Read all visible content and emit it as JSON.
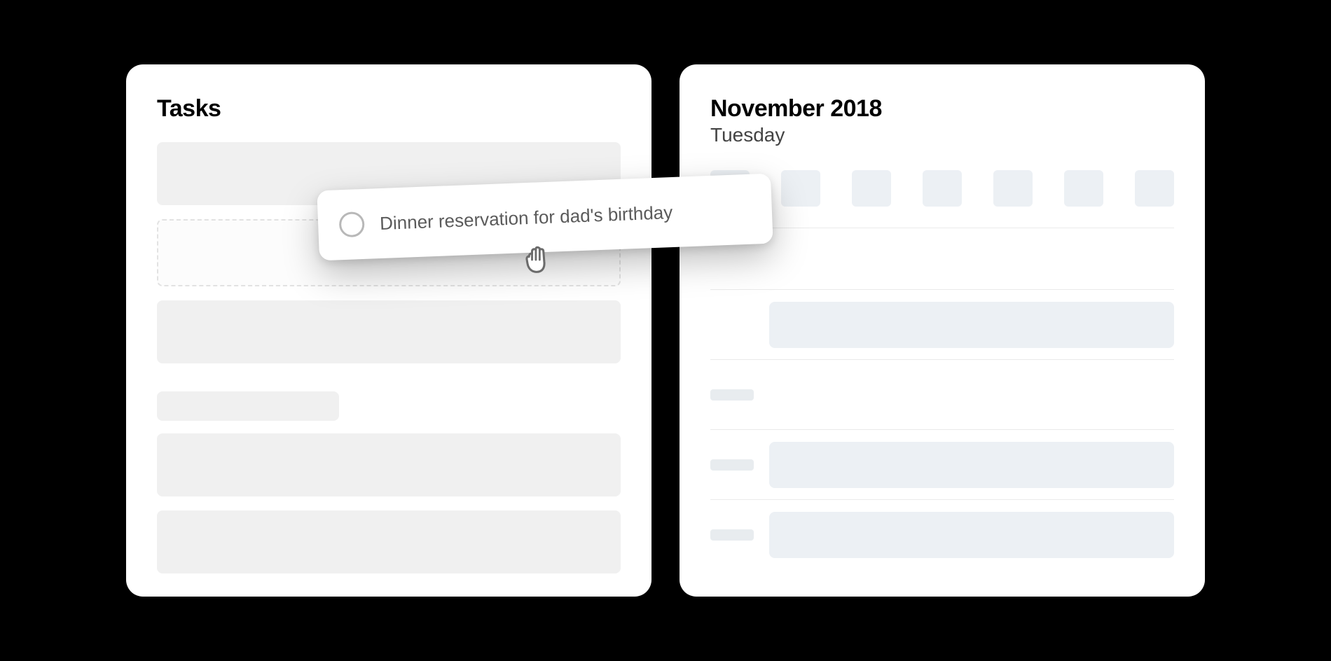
{
  "tasks": {
    "title": "Tasks"
  },
  "calendar": {
    "month_year": "November 2018",
    "day_name": "Tuesday"
  },
  "drag_item": {
    "label": "Dinner reservation for dad's birthday"
  }
}
